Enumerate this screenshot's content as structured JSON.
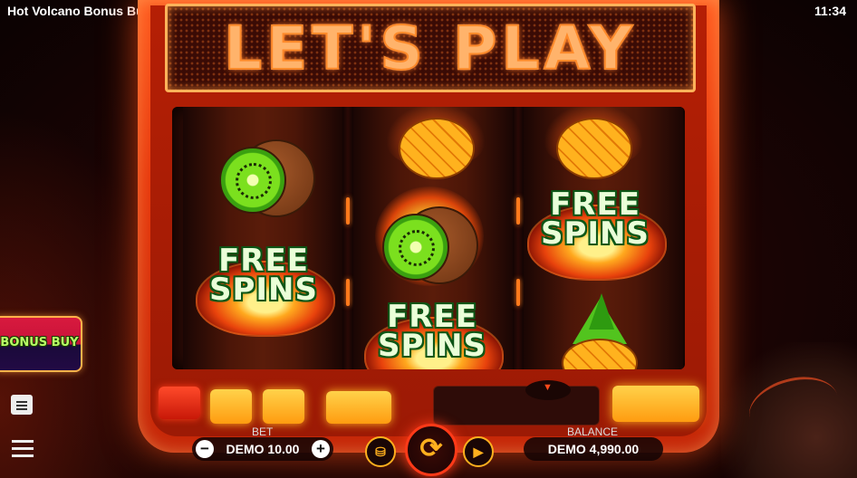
{
  "status_bar": {
    "app_title": "Hot Volcano Bonus Buy",
    "time": "11:34"
  },
  "marquee": {
    "text": "LET'S PLAY"
  },
  "reels": [
    [
      "kiwi",
      "free-spins"
    ],
    [
      "pineapple",
      "kiwi",
      "free-spins"
    ],
    [
      "pineapple",
      "free-spins",
      "pineapple"
    ]
  ],
  "symbols": {
    "free_spins_line1": "FREE",
    "free_spins_line2": "SPINS"
  },
  "bonus_buy": {
    "label": "BONUS BUY"
  },
  "bet": {
    "label": "BET",
    "value": "DEMO 10.00",
    "minus": "−",
    "plus": "+"
  },
  "balance": {
    "label": "BALANCE",
    "value": "DEMO 4,990.00"
  },
  "icons": {
    "coins": "coin-stack-icon",
    "spin": "spin-icon",
    "autoplay": "autoplay-icon",
    "history": "history-icon",
    "menu": "menu-icon"
  },
  "colors": {
    "cabinet": "#e8380c",
    "accent": "#ffb01e",
    "free_spins_text": "#eaffd8",
    "bonus_buy_text": "#b8ff66"
  }
}
